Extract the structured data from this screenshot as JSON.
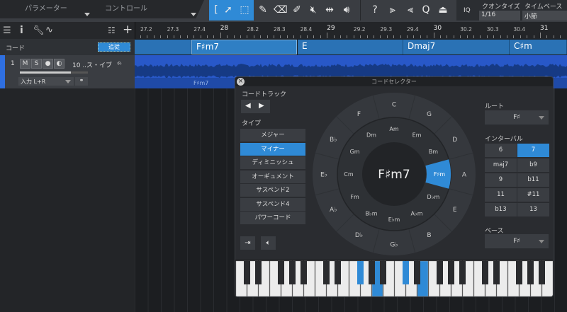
{
  "toolbar": {
    "tab_parameters": "パラメーター",
    "tab_control": "コントロール",
    "quantize_label": "クオンタイズ",
    "quantize_value": "1/16",
    "timebase_label": "タイムベース",
    "timebase_value": "小節",
    "iq": "IQ",
    "help": "?"
  },
  "ruler": {
    "labels": [
      "27.2",
      "27.3",
      "27.4",
      "28",
      "28.2",
      "28.3",
      "28.4",
      "29",
      "29.2",
      "29.3",
      "29.4",
      "30",
      "30.2",
      "30.3",
      "30.4",
      "31"
    ]
  },
  "chord_track": {
    "label": "コード",
    "follow_button": "追従",
    "chords": [
      {
        "name": "F♯m7",
        "selected": true
      },
      {
        "name": "E"
      },
      {
        "name": "Dmaj7"
      },
      {
        "name": "C♯m"
      }
    ],
    "audio_chord_label": "F♯m7"
  },
  "audio_track": {
    "number": "1",
    "mute": "M",
    "solo": "S",
    "name": "10 ..ス・イブ",
    "input": "入力 L+R"
  },
  "dialog": {
    "title": "コードセレクター",
    "chord_track_label": "コードトラック",
    "type_label": "タイプ",
    "types": [
      {
        "label": "メジャー"
      },
      {
        "label": "マイナー",
        "active": true
      },
      {
        "label": "ディミニッシュ"
      },
      {
        "label": "オーギュメント"
      },
      {
        "label": "サスペンド2"
      },
      {
        "label": "サスペンド4"
      },
      {
        "label": "パワーコード"
      }
    ],
    "current_chord": "F♯m7",
    "outer_ring": [
      "C",
      "G",
      "D",
      "A",
      "E",
      "B",
      "G♭",
      "D♭",
      "A♭",
      "E♭",
      "B♭",
      "F"
    ],
    "inner_ring": [
      "Am",
      "Em",
      "Bm",
      "F♯m",
      "D♭m",
      "A♭m",
      "E♭m",
      "B♭m",
      "Fm",
      "Cm",
      "Gm",
      "Dm"
    ],
    "inner_selected_index": 3,
    "root_label": "ルート",
    "root_value": "F♯",
    "interval_label": "インターバル",
    "intervals": [
      {
        "label": "6"
      },
      {
        "label": "7",
        "active": true
      },
      {
        "label": "maj7"
      },
      {
        "label": "b9"
      },
      {
        "label": "9"
      },
      {
        "label": "b11"
      },
      {
        "label": "11"
      },
      {
        "label": "#11"
      },
      {
        "label": "b13"
      },
      {
        "label": "13"
      }
    ],
    "bass_label": "ベース",
    "bass_value": "F♯",
    "keyboard_active_notes": [
      "F#",
      "A",
      "C#",
      "E"
    ]
  },
  "colors": {
    "accent": "#2f8ad6",
    "chord_block": "#2a72b5",
    "waveform": "#2858c8"
  }
}
